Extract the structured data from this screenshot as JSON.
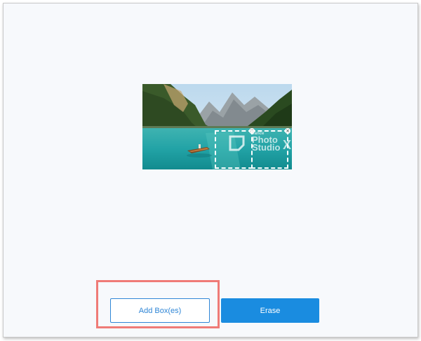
{
  "watermark": {
    "small": "Vance",
    "big": "Photo",
    "big2": "Studio",
    "x": "X"
  },
  "selection_boxes": [
    {
      "close_symbol": "×"
    },
    {
      "close_symbol": "×"
    }
  ],
  "buttons": {
    "add_boxes": "Add Box(es)",
    "erase": "Erase"
  },
  "colors": {
    "accent": "#1a8ce0",
    "highlight": "#ef7b77",
    "frame_bg": "#f7f9fc"
  }
}
